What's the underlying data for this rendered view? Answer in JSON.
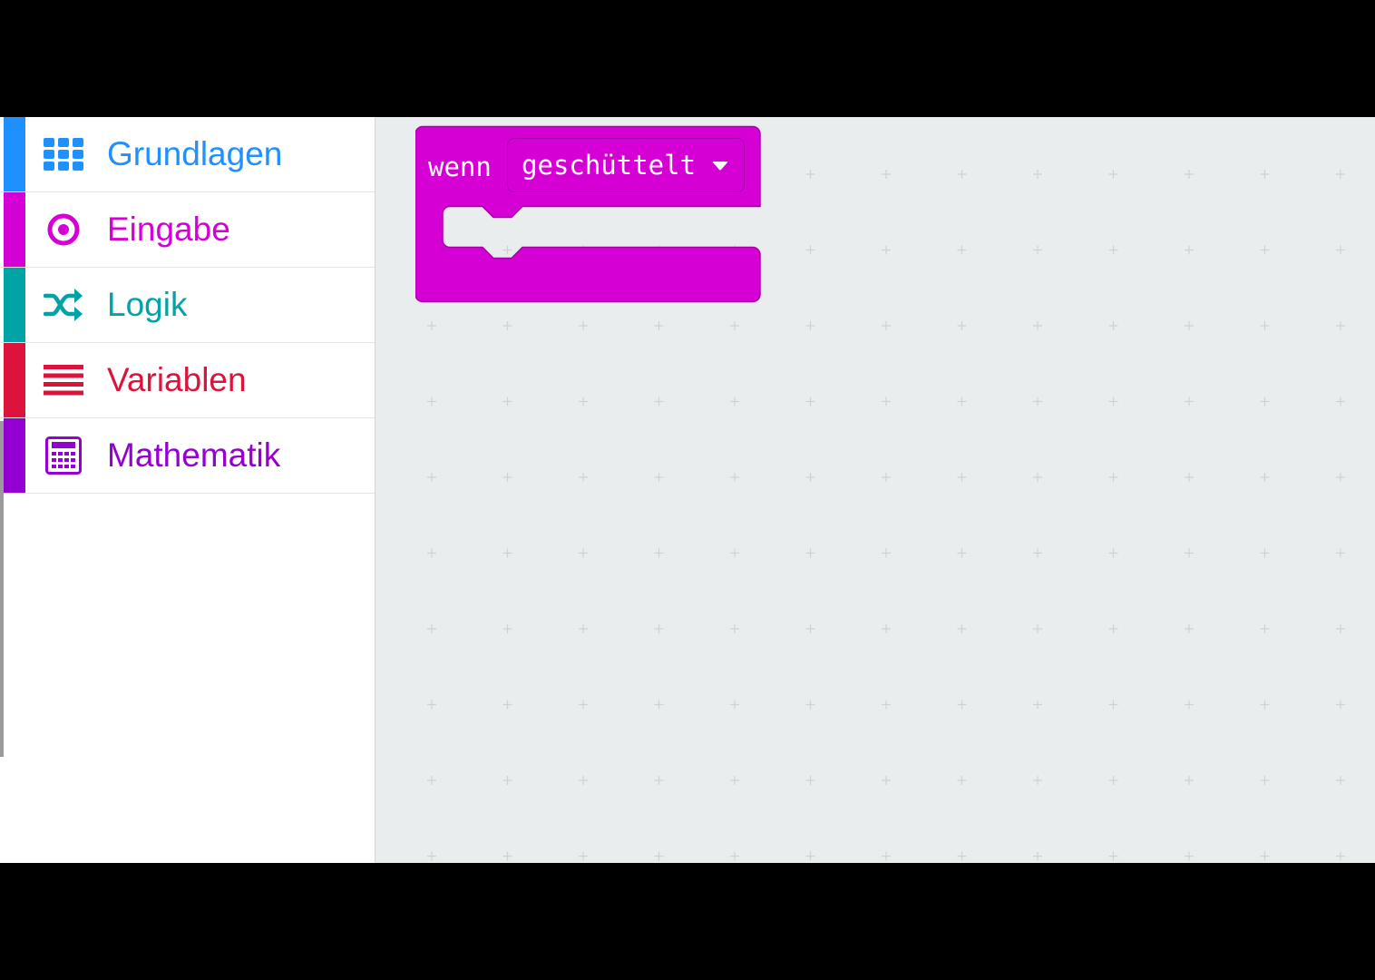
{
  "toolbox": {
    "categories": [
      {
        "label": "Grundlagen",
        "color": "#1e90ff",
        "icon": "grid-icon"
      },
      {
        "label": "Eingabe",
        "color": "#d400d4",
        "icon": "target-icon"
      },
      {
        "label": "Logik",
        "color": "#00a4a6",
        "icon": "shuffle-icon"
      },
      {
        "label": "Variablen",
        "color": "#dc143c",
        "icon": "list-icon"
      },
      {
        "label": "Mathematik",
        "color": "#9400d3",
        "icon": "calculator-icon"
      }
    ]
  },
  "workspace": {
    "background": "#e9eded",
    "block": {
      "label": "wenn",
      "dropdown_value": "geschüttelt",
      "color": "#d400d4",
      "category": "Eingabe"
    }
  }
}
